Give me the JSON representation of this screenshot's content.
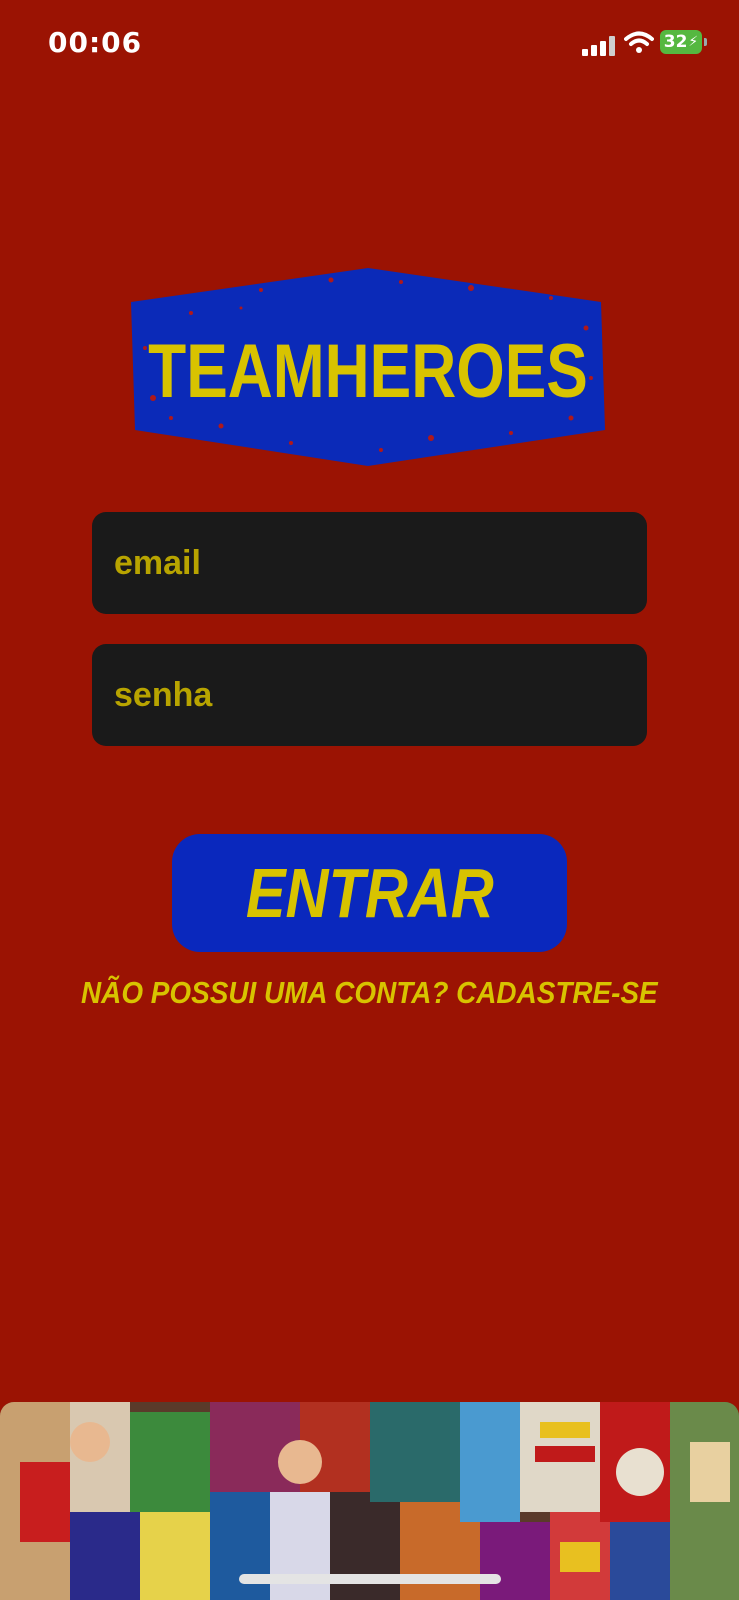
{
  "status_bar": {
    "time": "00:06",
    "battery": "32"
  },
  "logo": {
    "text": "TEAMHEROES"
  },
  "form": {
    "email_placeholder": "email",
    "password_placeholder": "senha"
  },
  "login_button": {
    "label": "ENTRAR"
  },
  "signup_link": {
    "label": "NÃO POSSUI UMA CONTA? CADASTRE-SE"
  },
  "colors": {
    "background": "#9b1303",
    "accent_yellow": "#d8c300",
    "button_blue": "#0a28bd",
    "field_bg": "#1a1a1a"
  }
}
